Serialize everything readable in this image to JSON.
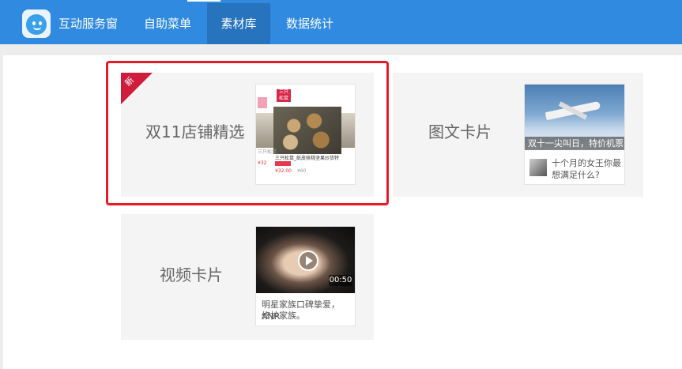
{
  "header": {
    "brand": "互动服务窗",
    "tabs": [
      {
        "label": "自助菜单",
        "active": false
      },
      {
        "label": "素材库",
        "active": true
      },
      {
        "label": "数据统计",
        "active": false
      }
    ],
    "colors": {
      "bar": "#2f8ae0",
      "active_tab": "#2773bd"
    }
  },
  "materials": {
    "cards": [
      {
        "title": "双11店铺精选",
        "badge": "新",
        "highlighted": true,
        "thumb": {
          "product_title": "三只松鼠_纸皮核桃坚果炒货特",
          "tag": "双11 火爆",
          "price": "¥32.",
          "price_decimal": "00",
          "old_price": "¥60",
          "side_title": "三只松鼠",
          "side_price": "¥32"
        }
      },
      {
        "title": "图文卡片",
        "highlighted": false,
        "thumb": {
          "caption": "双十一尖叫日，特价机票",
          "text_line1": "十个月的女王你最",
          "text_line2": "想满足什么?"
        }
      },
      {
        "title": "视频卡片",
        "highlighted": false,
        "thumb": {
          "duration": "00:50",
          "text_line1": "明星家族口碑挚爱，ANR",
          "text_line2": "修护家族。"
        }
      }
    ],
    "highlight_color": "#e81b2a"
  }
}
